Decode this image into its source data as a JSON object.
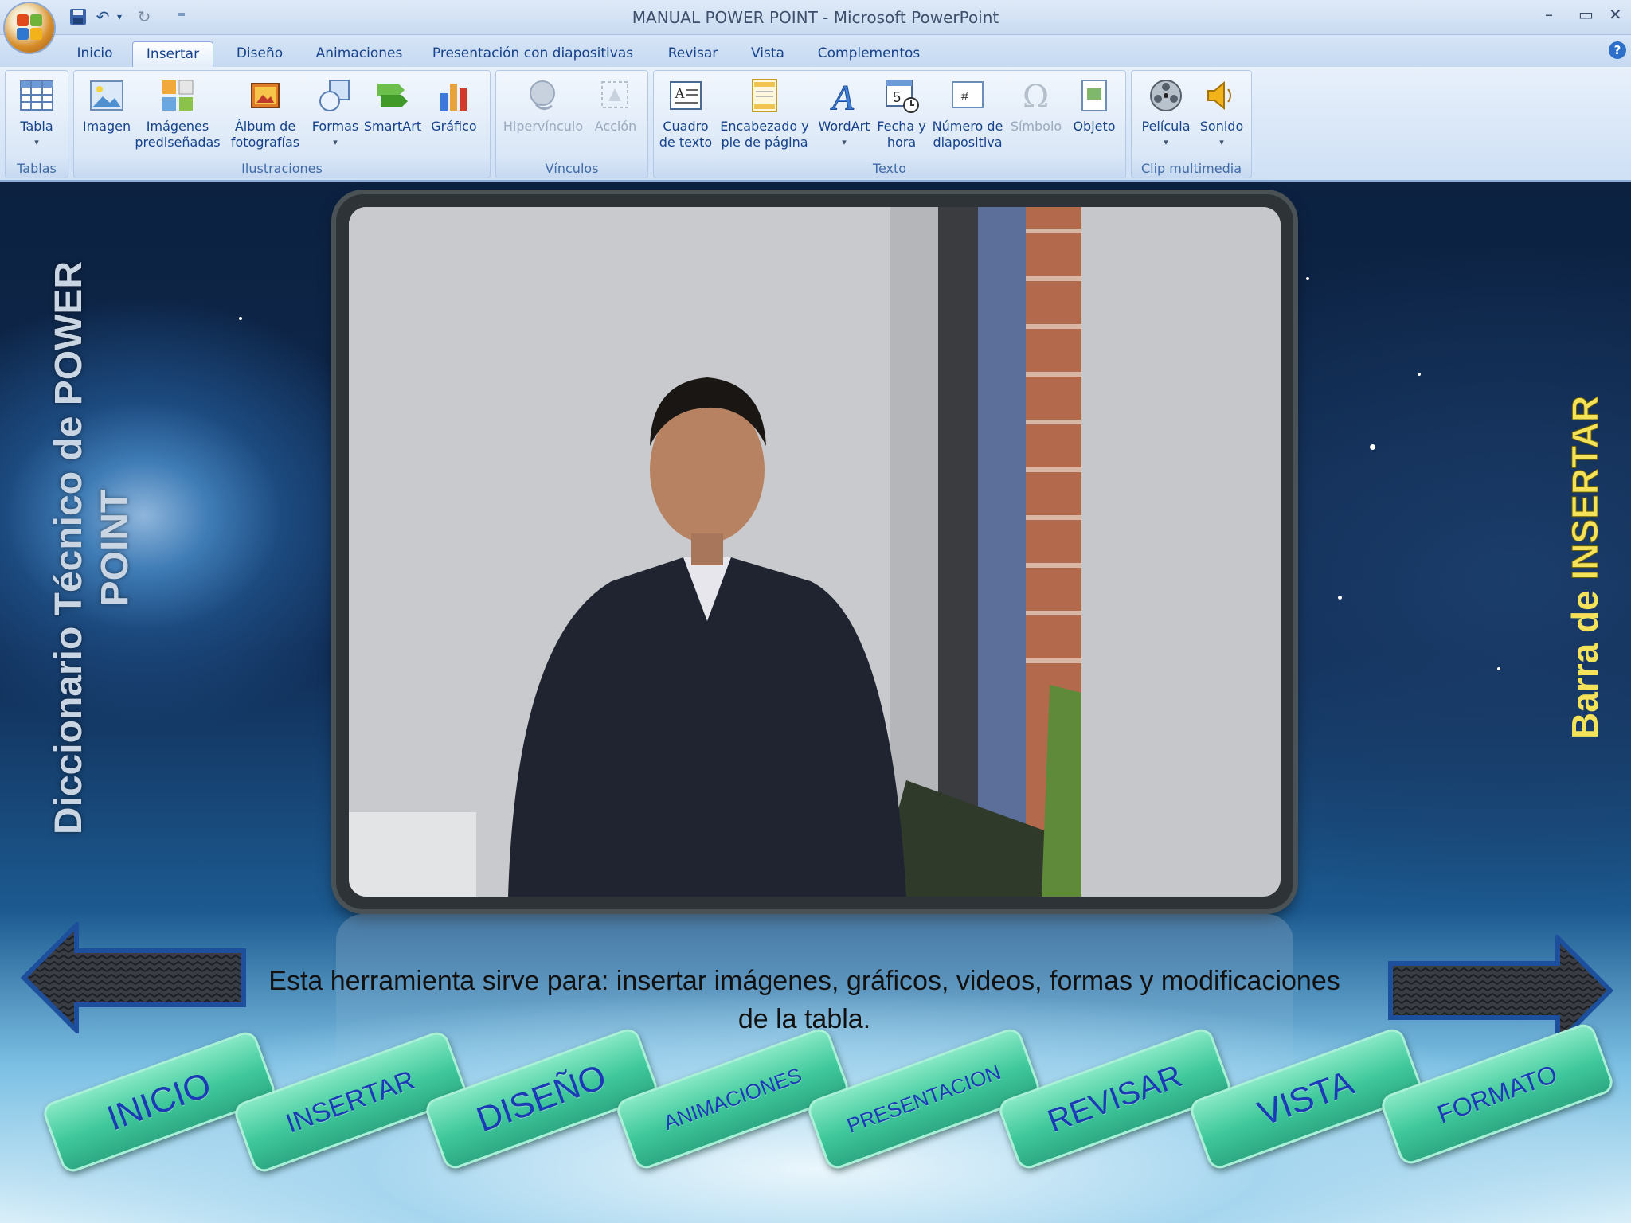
{
  "window": {
    "title": "MANUAL POWER POINT - Microsoft PowerPoint",
    "controls": {
      "minimize": "–",
      "maximize": "▭",
      "close": "✕"
    }
  },
  "quick_access": {
    "undo_icon": "↶",
    "redo_icon": "↻",
    "more_icon": "▾",
    "customize_icon": "⁼"
  },
  "tabs": [
    {
      "label": "Inicio"
    },
    {
      "label": "Insertar",
      "active": true
    },
    {
      "label": "Diseño"
    },
    {
      "label": "Animaciones"
    },
    {
      "label": "Presentación con diapositivas"
    },
    {
      "label": "Revisar"
    },
    {
      "label": "Vista"
    },
    {
      "label": "Complementos"
    }
  ],
  "help_icon": "?",
  "ribbon": {
    "groups": [
      {
        "label": "Tablas",
        "buttons": [
          {
            "label": "Tabla",
            "caret": "▾"
          }
        ]
      },
      {
        "label": "Ilustraciones",
        "buttons": [
          {
            "label": "Imagen"
          },
          {
            "label": "Imágenes prediseñadas"
          },
          {
            "label": "Álbum de fotografías",
            "caret": "▾"
          },
          {
            "label": "Formas",
            "caret": "▾"
          },
          {
            "label": "SmartArt"
          },
          {
            "label": "Gráfico"
          }
        ]
      },
      {
        "label": "Vínculos",
        "buttons": [
          {
            "label": "Hipervínculo",
            "disabled": true
          },
          {
            "label": "Acción",
            "disabled": true
          }
        ]
      },
      {
        "label": "Texto",
        "buttons": [
          {
            "label": "Cuadro de texto"
          },
          {
            "label": "Encabezado y pie de página"
          },
          {
            "label": "WordArt",
            "caret": "▾"
          },
          {
            "label": "Fecha y hora"
          },
          {
            "label": "Número de diapositiva"
          },
          {
            "label": "Símbolo",
            "disabled": true
          },
          {
            "label": "Objeto"
          }
        ]
      },
      {
        "label": "Clip multimedia",
        "buttons": [
          {
            "label": "Película",
            "caret": "▾"
          },
          {
            "label": "Sonido",
            "caret": "▾"
          }
        ]
      }
    ]
  },
  "slide": {
    "vertical_title_line1": "Diccionario Técnico de POWER",
    "vertical_title_line2": "POINT",
    "vertical_right_part1": "Barra de ",
    "vertical_right_part2": "INSERTAR",
    "caption_line1": "Esta herramienta sirve para:  insertar imágenes, gráficos, videos,  formas  y modificaciones",
    "caption_line2": "de la tabla.",
    "nav_buttons": [
      {
        "label": "INICIO"
      },
      {
        "label": "INSERTAR"
      },
      {
        "label": "DISEÑO"
      },
      {
        "label": "ANIMACIONES"
      },
      {
        "label": "PRESENTACION"
      },
      {
        "label": "REVISAR"
      },
      {
        "label": "VISTA"
      },
      {
        "label": "FORMATO"
      }
    ]
  },
  "colors": {
    "ribbon_text": "#15428b",
    "nav_button": "#3fc89b",
    "nav_text": "#1a3bb5",
    "right_title": "#f3e25a"
  }
}
